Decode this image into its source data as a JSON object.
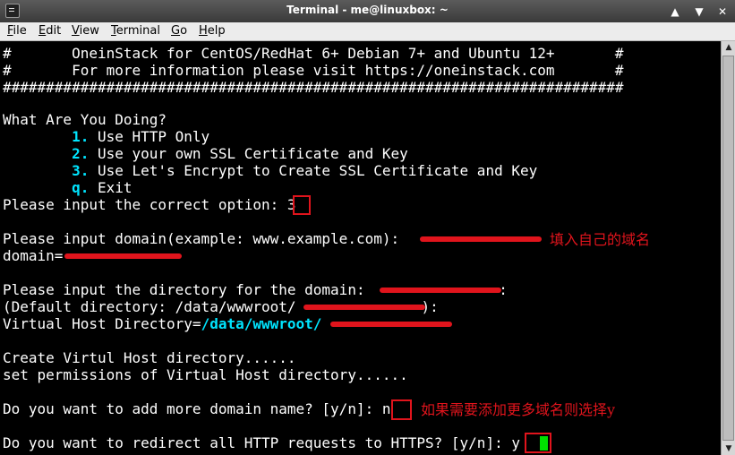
{
  "window": {
    "title": "Terminal - me@linuxbox: ~",
    "controls": [
      "▲",
      "▼",
      "✕"
    ]
  },
  "menu": [
    {
      "label": "File",
      "u": "F",
      "rest": "ile"
    },
    {
      "label": "Edit",
      "u": "E",
      "rest": "dit"
    },
    {
      "label": "View",
      "u": "V",
      "rest": "iew"
    },
    {
      "label": "Terminal",
      "u": "T",
      "rest": "erminal"
    },
    {
      "label": "Go",
      "u": "G",
      "rest": "o"
    },
    {
      "label": "Help",
      "u": "H",
      "rest": "elp"
    }
  ],
  "terminal": {
    "l0": "#       OneinStack for CentOS/RedHat 6+ Debian 7+ and Ubuntu 12+       #",
    "l1": "#       For more information please visit https://oneinstack.com       #",
    "l2": "########################################################################",
    "l4": "What Are You Doing?",
    "opt1_num": "1.",
    "opt1_text": " Use HTTP Only",
    "opt2_num": "2.",
    "opt2_text": " Use your own SSL Certificate and Key",
    "opt3_num": "3.",
    "opt3_text": " Use Let's Encrypt to Create SSL Certificate and Key",
    "optq_num": "q.",
    "optq_text": " Exit",
    "prompt_option": "Please input the correct option: ",
    "answer_option": "3",
    "prompt_domain": "Please input domain(example: www.example.com): ",
    "domain_label": "domain=",
    "prompt_dir": "Please input the directory for the domain:",
    "prompt_dir_end": " :",
    "default_dir": "(Default directory: /data/wwwroot/",
    "default_dir_end": "):",
    "vhost_label": "Virtual Host Directory=",
    "vhost_path": "/data/wwwroot/",
    "create_line": "Create Virtul Host directory......",
    "perm_line": "set permissions of Virtual Host directory......",
    "prompt_more": "Do you want to add more domain name? [y/n]: ",
    "answer_more": "n",
    "prompt_https": "Do you want to redirect all HTTP requests to HTTPS? [y/n]: ",
    "answer_https": "y"
  },
  "annotations": {
    "domain_note": "填入自己的域名",
    "more_note": "如果需要添加更多域名则选择y"
  },
  "colors": {
    "highlight": "#e0141c",
    "accent_cyan": "#00e5ff",
    "cursor": "#00e000"
  }
}
